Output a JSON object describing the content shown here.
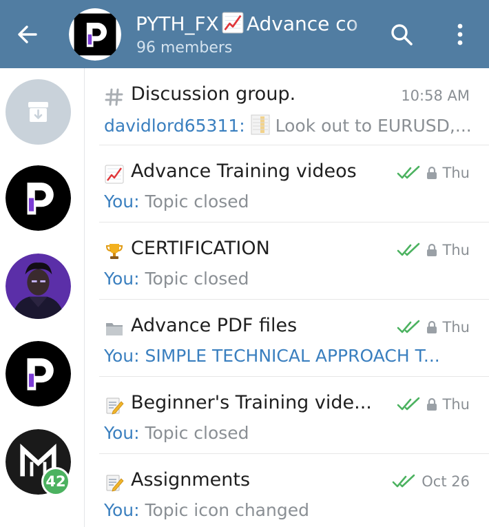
{
  "header": {
    "title_part1": "PYTH_FX",
    "title_part2": "Advance co",
    "title_emoji": "chart-increasing-icon",
    "subtitle": "96 members",
    "bg_color": "#517da2"
  },
  "sidebar": {
    "unread_badge": "42"
  },
  "topics": [
    {
      "icon": "hash-icon",
      "title": "Discussion group.",
      "time": "10:58 AM",
      "sender": "davidlord65311:",
      "preview": "Look out to EURUSD,...",
      "read": false,
      "locked": false
    },
    {
      "icon": "chart-increasing-icon",
      "title": "Advance Training videos",
      "time": "Thu",
      "sender": "You:",
      "preview": "Topic closed",
      "read": true,
      "locked": true
    },
    {
      "icon": "trophy-icon",
      "title": "CERTIFICATION",
      "time": "Thu",
      "sender": "You:",
      "preview": "Topic closed",
      "read": true,
      "locked": true
    },
    {
      "icon": "folder-icon",
      "title": "Advance PDF files",
      "time": "Thu",
      "sender": "You:",
      "preview": "SIMPLE TECHNICAL APPROACH T...",
      "read": true,
      "locked": true
    },
    {
      "icon": "memo-icon",
      "title": "Beginner's Training vide...",
      "time": "Thu",
      "sender": "You:",
      "preview": "Topic closed",
      "read": true,
      "locked": true
    },
    {
      "icon": "memo-icon",
      "title": "Assignments",
      "time": "Oct 26",
      "sender": "You:",
      "preview": "Topic icon changed",
      "read": true,
      "locked": false
    }
  ],
  "colors": {
    "accent_blue": "#3a7fbf",
    "read_tick_green": "#4cb260",
    "badge_green": "#4cb260"
  }
}
